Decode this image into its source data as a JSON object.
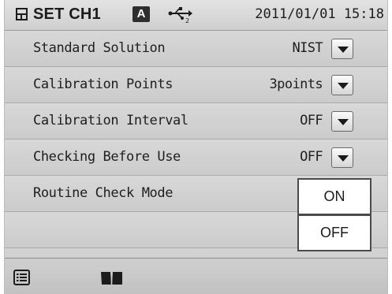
{
  "header": {
    "title": "SET CH1",
    "badge": "A",
    "datetime": "2011/01/01 15:18",
    "icons": [
      "settings-box-icon",
      "usb-icon"
    ]
  },
  "rows": [
    {
      "label": "Standard Solution",
      "value": "NIST",
      "dropdown": true
    },
    {
      "label": "Calibration Points",
      "value": "3points",
      "dropdown": true
    },
    {
      "label": "Calibration Interval",
      "value": "OFF",
      "dropdown": true
    },
    {
      "label": "Checking Before Use",
      "value": "OFF",
      "dropdown": true
    },
    {
      "label": "Routine Check Mode",
      "value": "",
      "dropdown": false
    }
  ],
  "popup": {
    "options": [
      "ON",
      "OFF"
    ]
  },
  "footer": {
    "icons": [
      "list-icon",
      "book-icon"
    ]
  },
  "colors": {
    "screen_bg": "#d2d2d2",
    "header_bg": "#dcdcdc",
    "badge_bg": "#2e2e2e",
    "popup_border": "#4a4a4a"
  }
}
